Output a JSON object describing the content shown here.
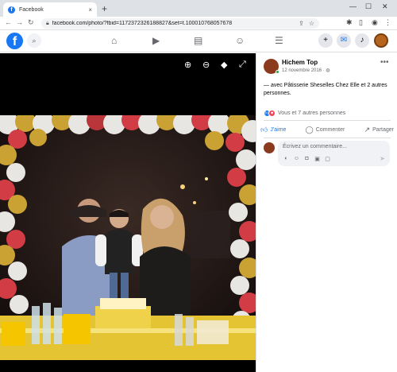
{
  "browser": {
    "tab_title": "Facebook",
    "tab_close": "×",
    "new_tab": "+",
    "url": "facebook.com/photo/?fbid=1172372326188827&set=t.100010768057678",
    "window_controls": [
      "—",
      "☐",
      "✕"
    ]
  },
  "fb": {
    "logo": "f"
  },
  "post": {
    "author": "Hichem Top",
    "date": "12 novembre 2016 · ◍",
    "body": "— avec Pâtisserie Sheselles Chez Elle et 2 autres personnes.",
    "reactions": "Vous et 7 autres personnes",
    "like_label": "J'aime",
    "comment_label": "Commenter",
    "share_label": "Partager",
    "comment_placeholder": "Écrivez un commentaire..."
  },
  "colors": {
    "brand": "#1877f2",
    "love": "#f33e58",
    "online": "#31a24c"
  }
}
